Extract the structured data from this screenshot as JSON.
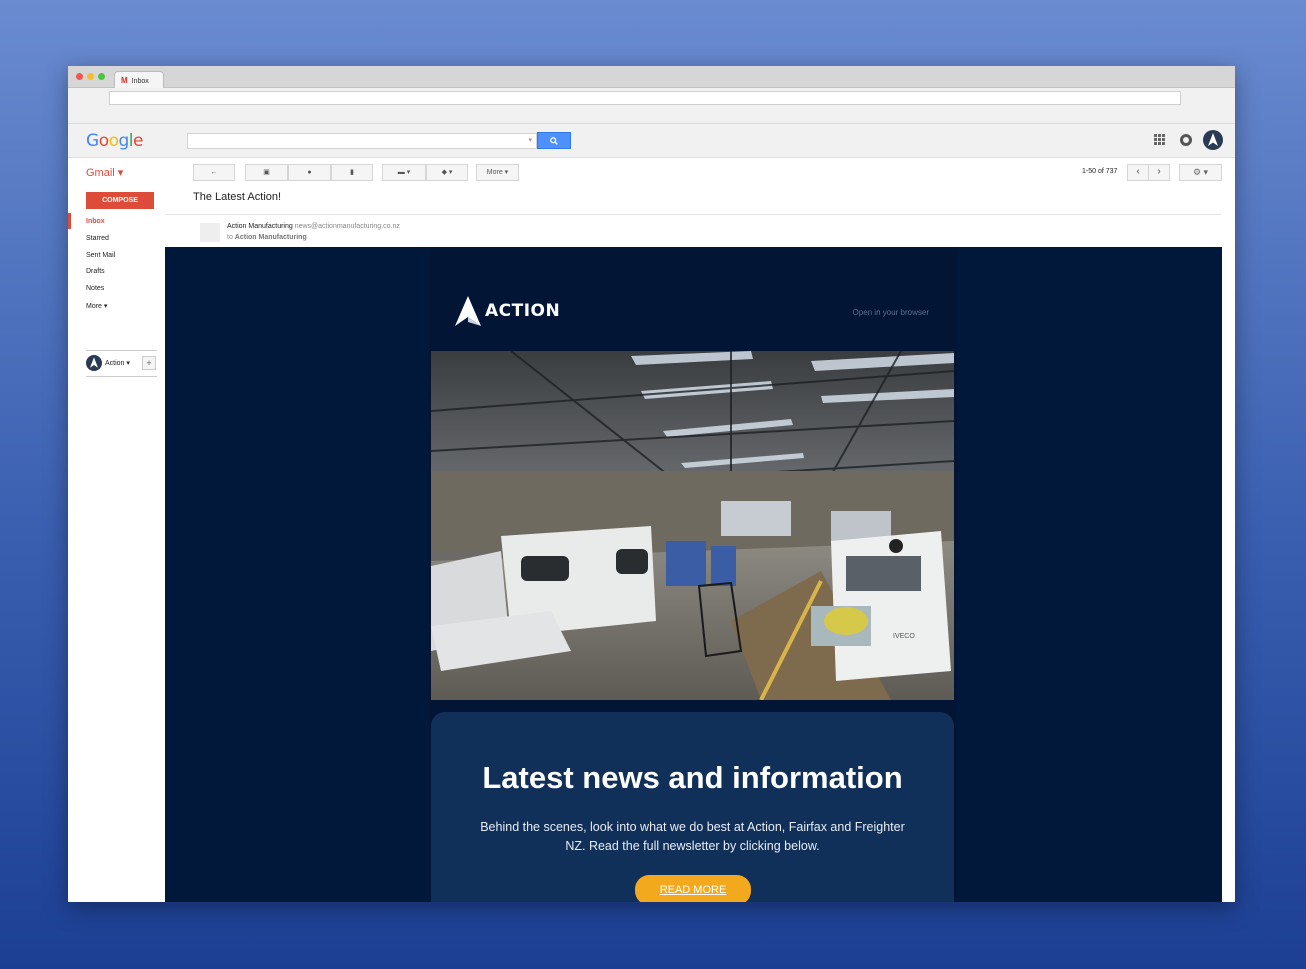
{
  "browser": {
    "tab_label": "Inbox",
    "tab_icon": "gmail-m-icon"
  },
  "google": {
    "logo_letters": [
      "G",
      "o",
      "o",
      "g",
      "l",
      "e"
    ],
    "logo_colors": [
      "#4285f4",
      "#ea4335",
      "#fbbc05",
      "#4285f4",
      "#34a853",
      "#ea4335"
    ]
  },
  "gmail": {
    "label": "Gmail ▾",
    "compose_label": "COMPOSE",
    "nav": [
      {
        "label": "Inbox",
        "active": true
      },
      {
        "label": "Starred"
      },
      {
        "label": "Sent Mail"
      },
      {
        "label": "Drafts"
      },
      {
        "label": "Notes"
      },
      {
        "label": "More ▾"
      }
    ],
    "hangouts_name": "Action ▾",
    "hangouts_add": "+"
  },
  "toolbar": {
    "back": "←",
    "archive": "▣",
    "spam": "●",
    "delete": "▮",
    "move": "▬ ▾",
    "labels": "◆ ▾",
    "more": "More ▾",
    "pager": "1-50 of 737",
    "prev": "‹",
    "next": "›",
    "settings": "⚙ ▾"
  },
  "message": {
    "subject": "The Latest Action!",
    "sender_name": "Action Manufacturing",
    "sender_email": "news@actionmanufacturing.co.nz",
    "to_prefix": "to",
    "to_name": "Action Manufacturing"
  },
  "newsletter": {
    "brand_name": "ACTION",
    "open_in_browser": "Open in your browser",
    "headline": "Latest news and information",
    "body": "Behind the scenes, look into what we do best at Action, Fairfax and Freighter NZ. Read the full newsletter by clicking below.",
    "cta": "READ MORE",
    "colors": {
      "background": "#02183a",
      "box": "#10305a",
      "cta": "#f3a91d"
    }
  }
}
